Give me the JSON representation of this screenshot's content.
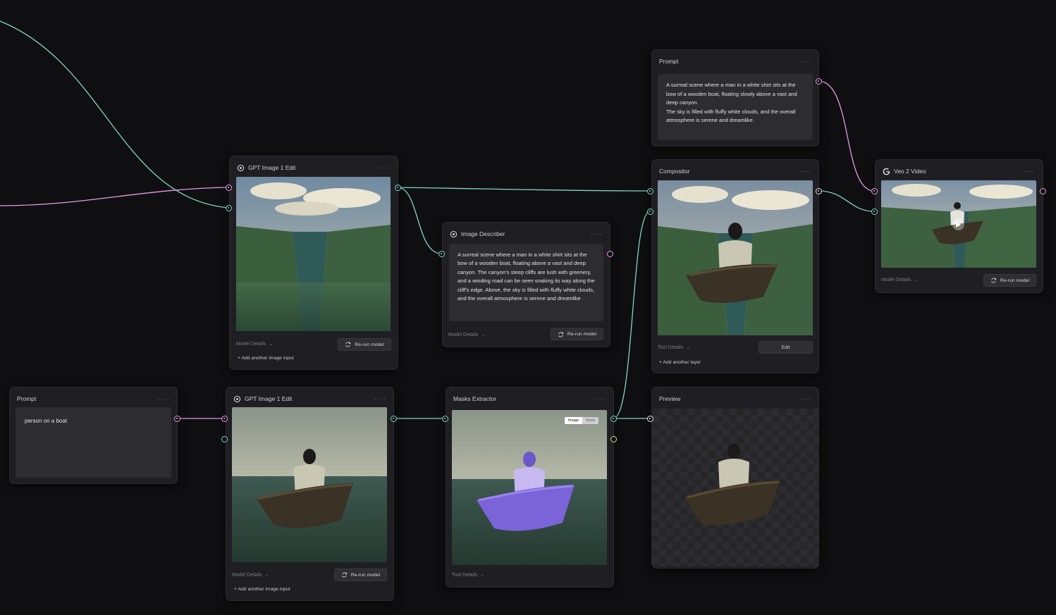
{
  "nodes": {
    "prompt_top": {
      "title": "Prompt",
      "text": "A surreal scene where a man in a white shirt sits at the bow of a wooden boat, floating slowly above a vast and deep canyon.\nThe sky is filled with fluffy white clouds, and the overall atmosphere is serene and dreamlike."
    },
    "gpt_edit_top": {
      "title": "GPT Image 1 Edit",
      "model_details": "Model Details",
      "rerun": "Re-run model",
      "add_input": "+ Add another image input"
    },
    "image_describer": {
      "title": "Image Describer",
      "text": "A surreal scene where a man in a white shirt sits at the bow of a wooden boat, floating above a vast and deep canyon. The canyon's steep cliffs are lush with greenery, and a winding road can be seen snaking its way along the cliff's edge. Above, the sky is filled with fluffy white clouds, and the overall atmosphere is serene and dreamlike",
      "model_details": "Model Details",
      "rerun": "Re-run model"
    },
    "compositor": {
      "title": "Compositor",
      "tool_details": "Tool Details",
      "edit": "Edit",
      "add_layer": "+ Add another layer"
    },
    "veo_video": {
      "title": "Veo 2 Video",
      "model_details": "Model Details",
      "rerun": "Re-run model"
    },
    "prompt_bottom": {
      "title": "Prompt",
      "text": "person on a boat"
    },
    "gpt_edit_bottom": {
      "title": "GPT Image 1 Edit",
      "model_details": "Model Details",
      "rerun": "Re-run model",
      "add_input": "+ Add another image input"
    },
    "masks_extractor": {
      "title": "Masks Extractor",
      "toggle_image": "Image",
      "toggle_mask": "Mask",
      "tool_details": "Tool Details"
    },
    "preview": {
      "title": "Preview"
    }
  },
  "menu_glyph": "····",
  "colors": {
    "background": "#0f0f12",
    "node": "#1f1f23",
    "wire_teal": "#7fd6c3",
    "wire_pink": "#e59ce0",
    "mask_purple": "#8a6fe0"
  },
  "icons": [
    "openai-icon",
    "google-icon",
    "more-icon",
    "refresh-icon",
    "chevron-down-icon",
    "play-icon"
  ]
}
